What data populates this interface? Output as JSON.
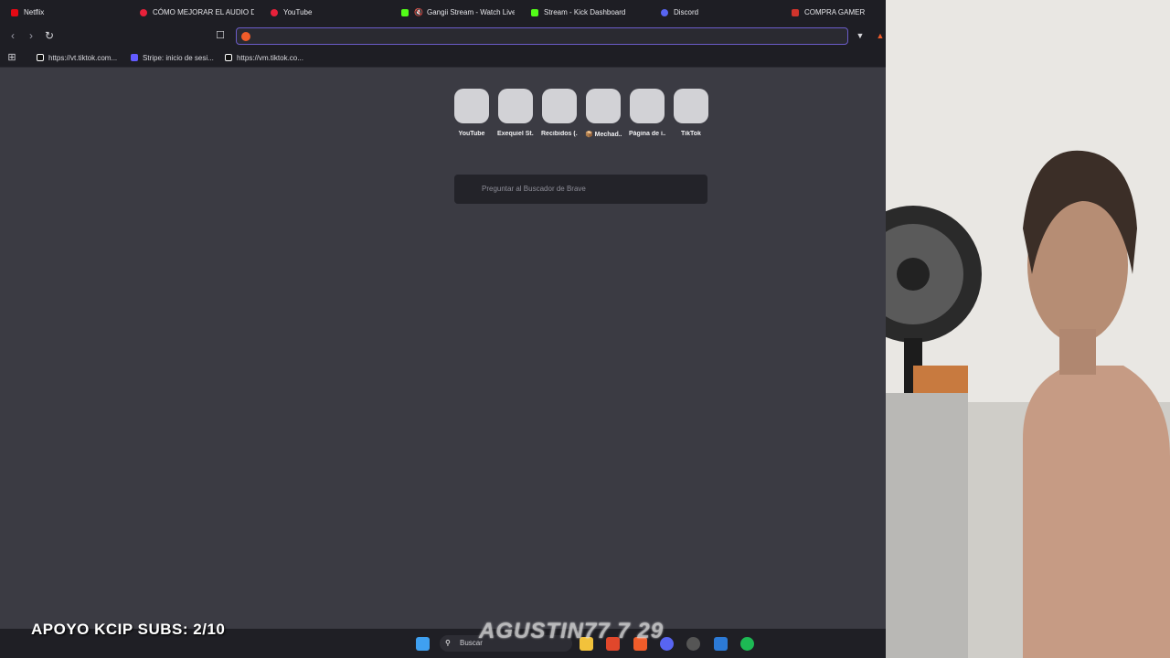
{
  "tabs": [
    {
      "label": "Netflix",
      "color": "#e50914"
    },
    {
      "label": "CÓMO MEJORAR EL AUDIO D",
      "color": "#e8213a"
    },
    {
      "label": "YouTube",
      "color": "#e8213a"
    },
    {
      "label": "Gangii Stream - Watch Live",
      "color": "#53fc18"
    },
    {
      "label": "Stream - Kick Dashboard",
      "color": "#53fc18"
    },
    {
      "label": "Discord",
      "color": "#5865f2"
    },
    {
      "label": "COMPRA GAMER",
      "color": "#d0342c"
    }
  ],
  "toolbar": {
    "back_icon": "chevron-left-icon",
    "forward_icon": "chevron-right-icon",
    "reload_icon": "reload-icon",
    "bookmark_icon": "bookmark-icon",
    "url_value": "",
    "accent": "#6b5cc9"
  },
  "bookmarks": [
    {
      "label": "https://vt.tiktok.com...",
      "color": "#ffffff"
    },
    {
      "label": "Stripe: inicio de sesi...",
      "color": "#635bff"
    },
    {
      "label": "https://vm.tiktok.co...",
      "color": "#ffffff"
    }
  ],
  "top_sites": [
    {
      "label": "YouTube"
    },
    {
      "label": "Exequiel St..."
    },
    {
      "label": "Recibidos (..."
    },
    {
      "label": "📦 Mechad..."
    },
    {
      "label": "Página de i..."
    },
    {
      "label": "TikTok"
    }
  ],
  "ask_box": {
    "placeholder": "Preguntar al Buscador de Brave"
  },
  "taskbar": {
    "search_label": "Buscar"
  },
  "overlay": {
    "subs_text": "APOYO KCIP SUBS: 2/10",
    "name_text": "AGUSTIN77 7 29"
  }
}
